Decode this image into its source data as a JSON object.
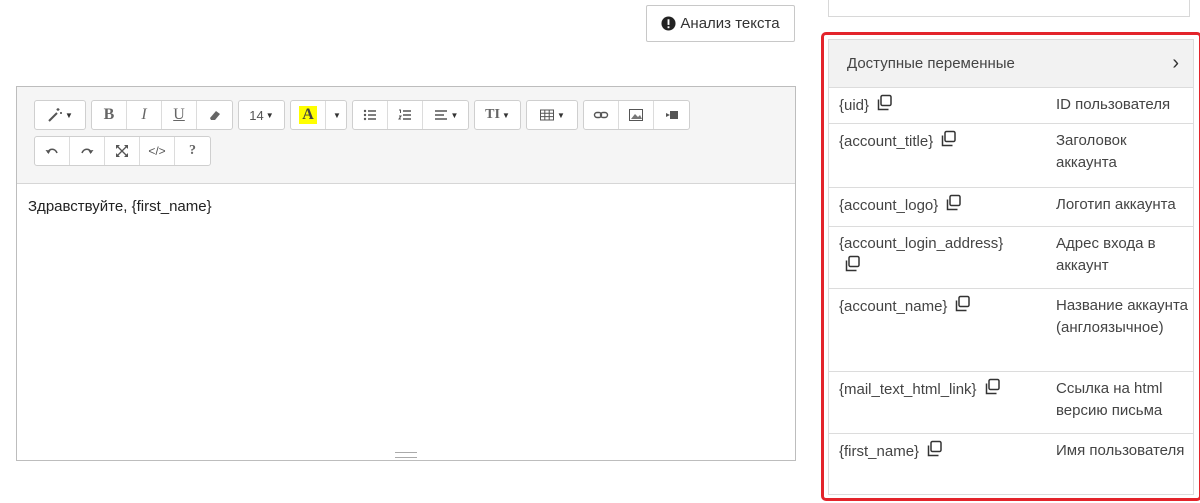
{
  "analyze": {
    "label": "Анализ текста"
  },
  "toolbar": {
    "font_size": "14"
  },
  "editor": {
    "content": "Здравствуйте, {first_name}"
  },
  "variables": {
    "title": "Доступные переменные",
    "items": [
      {
        "name": "{uid}",
        "desc": "ID пользователя"
      },
      {
        "name": "{account_title}",
        "desc": "Заголовок аккаунта"
      },
      {
        "name": "{account_logo}",
        "desc": "Логотип аккаунта"
      },
      {
        "name": "{account_login_address}",
        "desc": "Адрес входа в аккаунт"
      },
      {
        "name": "{account_name}",
        "desc": "Название аккаунта (англоязычное)"
      },
      {
        "name": "{mail_text_html_link}",
        "desc": "Ссылка на html версию письма"
      },
      {
        "name": "{first_name}",
        "desc": "Имя пользователя"
      }
    ]
  },
  "colors": {
    "highlight_border": "#e3242b",
    "text_color_swatch": "#ffff00"
  }
}
